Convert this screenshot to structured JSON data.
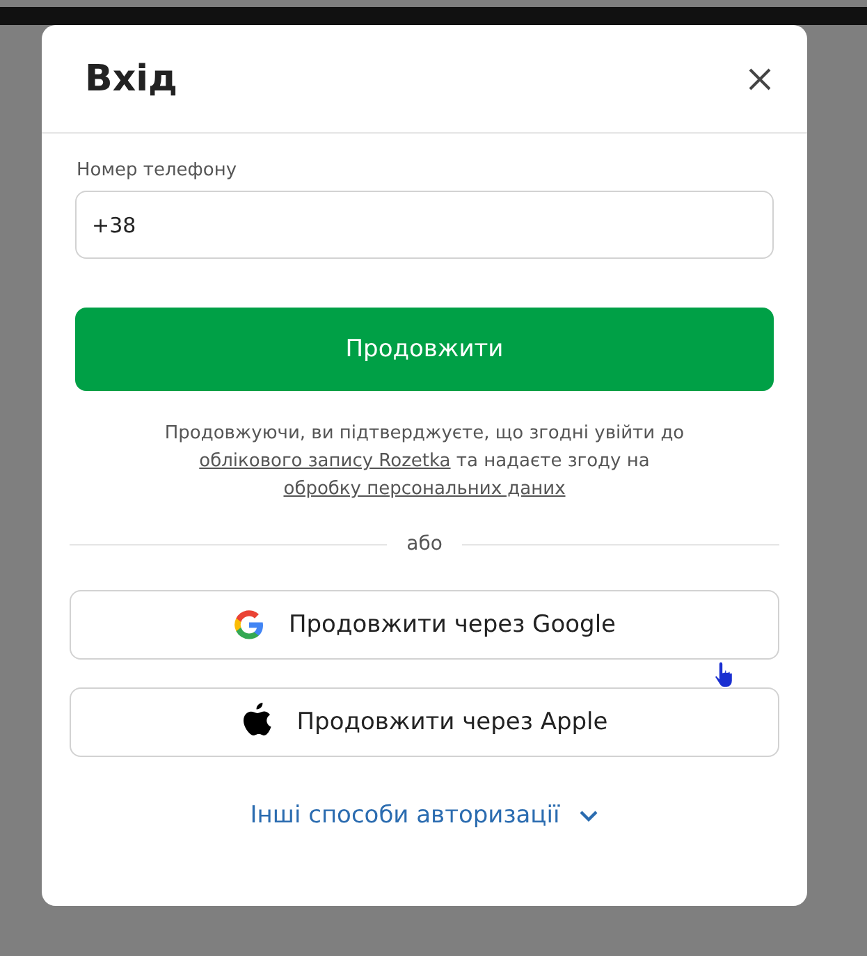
{
  "dialog": {
    "title": "Вхід",
    "phone": {
      "label": "Номер телефону",
      "value": "+38"
    },
    "submit": "Продовжити",
    "consent": [
      {
        "kind": "text",
        "text": "Продовжуючи, ви підтверджуєте, що згодні увійти до"
      },
      {
        "kind": "link",
        "text": "облікового запису Rozetka"
      },
      {
        "kind": "text",
        "text": " та надаєте згоду на"
      },
      {
        "kind": "link",
        "text": "обробку персональних даних"
      }
    ],
    "divider": "або",
    "providers": [
      {
        "kind": "google",
        "label": "Продовжити через Google"
      },
      {
        "kind": "apple",
        "label": "Продовжити через Apple"
      }
    ],
    "more": "Інші способи авторизації"
  }
}
